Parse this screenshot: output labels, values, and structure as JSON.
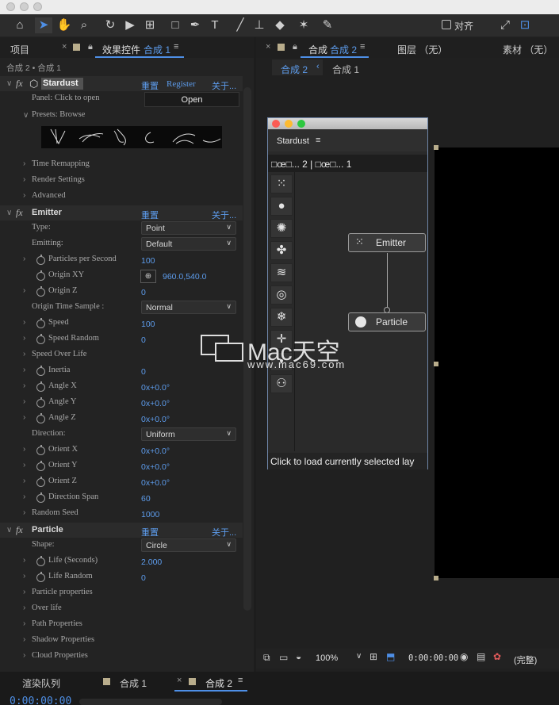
{
  "toolbar": {
    "align_label": "对齐"
  },
  "left_panel": {
    "tab_project": "项目",
    "tab_effect_controls": "效果控件",
    "tab_effect_controls_comp": "合成 1",
    "breadcrumb": "合成 2 • 合成 1",
    "stardust": {
      "name": "Stardust",
      "reset": "重置",
      "register": "Register",
      "about": "关于...",
      "panel_label": "Panel: Click to open",
      "open_button": "Open",
      "presets_label": "Presets: Browse",
      "time_remapping": "Time Remapping",
      "render_settings": "Render Settings",
      "advanced": "Advanced"
    },
    "emitter": {
      "name": "Emitter",
      "reset": "重置",
      "about": "关于...",
      "type_label": "Type:",
      "type_value": "Point",
      "emitting_label": "Emitting:",
      "emitting_value": "Default",
      "pps_label": "Particles per Second",
      "pps_value": "100",
      "originxy_label": "Origin XY",
      "originxy_value": "960.0,540.0",
      "originz_label": "Origin Z",
      "originz_value": "0",
      "ots_label": "Origin Time Sample :",
      "ots_value": "Normal",
      "speed_label": "Speed",
      "speed_value": "100",
      "speedrand_label": "Speed Random",
      "speedrand_value": "0",
      "speedover_label": "Speed Over Life",
      "inertia_label": "Inertia",
      "inertia_value": "0",
      "anglex_label": "Angle X",
      "anglex_value": "0x+0.0°",
      "angley_label": "Angle Y",
      "angley_value": "0x+0.0°",
      "anglez_label": "Angle Z",
      "anglez_value": "0x+0.0°",
      "direction_label": "Direction:",
      "direction_value": "Uniform",
      "orientx_label": "Orient X",
      "orientx_value": "0x+0.0°",
      "orienty_label": "Orient Y",
      "orienty_value": "0x+0.0°",
      "orientz_label": "Orient Z",
      "orientz_value": "0x+0.0°",
      "dirspan_label": "Direction Span",
      "dirspan_value": "60",
      "seed_label": "Random Seed",
      "seed_value": "1000"
    },
    "particle": {
      "name": "Particle",
      "reset": "重置",
      "about": "关于...",
      "shape_label": "Shape:",
      "shape_value": "Circle",
      "life_label": "Life (Seconds)",
      "life_value": "2.000",
      "liferand_label": "Life Random",
      "liferand_value": "0",
      "props": "Particle properties",
      "overlife": "Over life",
      "path": "Path Properties",
      "shadow": "Shadow Properties",
      "cloud": "Cloud Properties"
    }
  },
  "right_panel": {
    "tab_comp": "合成",
    "tab_comp_name": "合成 2",
    "tab_layer": "图层  （无）",
    "tab_footage": "素材  （无）",
    "crumb_active": "合成 2",
    "crumb_next": "合成 1",
    "stardust_window": {
      "title": "Stardust",
      "header": "□œ□... 2   |   □œ□... 1",
      "node_emitter": "Emitter",
      "node_particle": "Particle",
      "footer": "Click to load currently selected lay"
    },
    "bottom_bar": {
      "zoom": "100%",
      "timecode": "0:00:00:00",
      "quality": "(完整)"
    }
  },
  "bottom_panel": {
    "tab_render_queue": "渲染队列",
    "tab_comp1": "合成 1",
    "tab_comp2": "合成 2",
    "timecode": "0:00:00:00"
  },
  "watermark": {
    "brand": "Mac天空",
    "url": "www.mac69.com"
  },
  "colors": {
    "accent_blue": "#5d9cec",
    "bg": "#232323"
  }
}
